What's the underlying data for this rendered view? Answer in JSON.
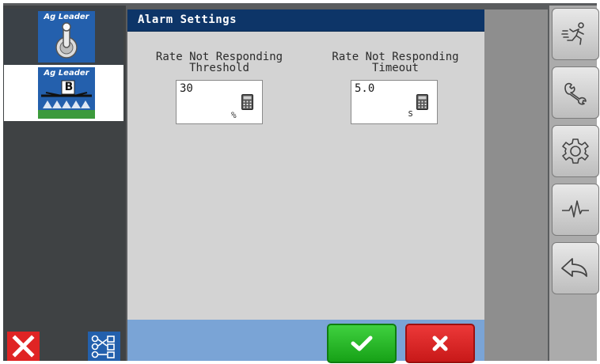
{
  "left_panel": {
    "apps": [
      {
        "brand": "Ag Leader",
        "icon": "toggle-switch-icon"
      },
      {
        "brand": "Ag Leader",
        "badge": "B",
        "icon": "boom-sprayer-icon"
      }
    ],
    "footer": {
      "close_icon": "close-icon",
      "nodes_icon": "network-nodes-icon"
    }
  },
  "dialog": {
    "title": "Alarm Settings",
    "fields": [
      {
        "label": "Rate Not Responding\nThreshold",
        "value": "30",
        "unit": "%"
      },
      {
        "label": "Rate Not Responding\nTimeout",
        "value": "5.0",
        "unit": "s"
      }
    ],
    "ok_icon": "checkmark-icon",
    "cancel_icon": "x-icon"
  },
  "sidebar": {
    "buttons": [
      "running-person-icon",
      "wrench-icon",
      "gear-icon",
      "pulse-icon",
      "back-arrow-icon"
    ]
  },
  "colors": {
    "title_bar": "#0d3568",
    "app_blue": "#2460ad",
    "ok_green": "#17a117",
    "cancel_red": "#c81919",
    "bottom_bar": "#7aa4d6"
  }
}
